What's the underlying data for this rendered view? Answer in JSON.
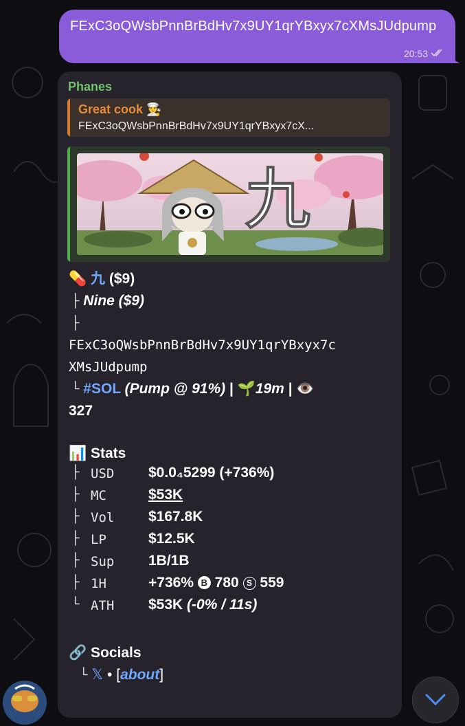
{
  "outgoing": {
    "text": "FExC3oQWsbPnnBrBdHv7x9UY1qrYBxyx7cXMsJUdpump",
    "time": "20:53",
    "status_icon": "double-check-icon"
  },
  "message": {
    "sender": "Phanes",
    "reply": {
      "name": "Great cook 👨‍🍳",
      "text": "FExC3oQWsbPnnBrBdHv7x9UY1qrYBxyx7cX..."
    },
    "preview_glyph": "九",
    "token": {
      "pill_emoji": "💊",
      "symbol": "九",
      "symbol_price": "($9)",
      "name_line": "Nine  ($9)",
      "address_line1": "FExC3oQWsbPnnBrBdHv7x9UY1qrYBxyx7c",
      "address_line2": "XMsJUdpump",
      "chain_tag": "#SOL",
      "pump_text": "(Pump @ ",
      "pump_pct": "91%",
      "pump_close": ")",
      "sep1": " | ",
      "seedling_emoji": "🌱",
      "age": "19m",
      "sep2": " | ",
      "eye_emoji": "👁️",
      "views": "327"
    },
    "stats": {
      "icon": "📊",
      "title": "Stats",
      "rows": [
        {
          "label": "USD",
          "value": "$0.0₄5299 (+736%)"
        },
        {
          "label": "MC",
          "value": "$53K"
        },
        {
          "label": "Vol",
          "value": "$167.8K"
        },
        {
          "label": "LP",
          "value": "$12.5K"
        },
        {
          "label": "Sup",
          "value": "1B/1B"
        },
        {
          "label": "1H",
          "value_main": "+736%",
          "b_icon": "B",
          "b_value": "780",
          "s_icon": "S",
          "s_value": "559"
        },
        {
          "label": "ATH",
          "value_main": "$53K",
          "value_extra": "(-0% / 11s)"
        }
      ]
    },
    "socials": {
      "icon": "🔗",
      "title": "Socials",
      "x_glyph": "𝕏",
      "dot": " • [",
      "about": "about",
      "close": "]"
    }
  },
  "tree": {
    "branch": "├",
    "last": "└"
  },
  "colors": {
    "outgoing_bubble": "#8b5cd9",
    "card": "#27232d",
    "sender": "#6fc26a",
    "reply_name": "#e78a3a",
    "link": "#6ea8ff"
  }
}
